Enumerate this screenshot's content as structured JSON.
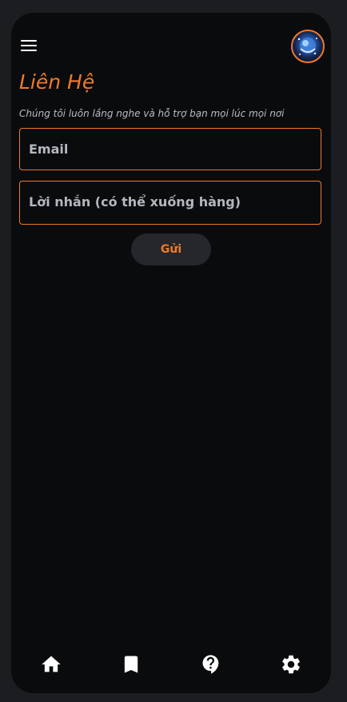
{
  "header": {
    "menu_icon": "hamburger-menu-icon",
    "avatar_icon": "user-avatar-icon"
  },
  "contact": {
    "title": "Liên Hệ",
    "subtitle": "Chúng tôi luôn lắng nghe và hỗ trợ bạn mọi lúc mọi nơi",
    "email_placeholder": "Email",
    "email_value": "",
    "message_placeholder": "Lời nhắn (có thể xuống hàng)",
    "message_value": "",
    "send_label": "Gửi"
  },
  "bottom_nav": {
    "items": [
      {
        "icon": "home-icon"
      },
      {
        "icon": "bookmark-icon"
      },
      {
        "icon": "help-icon"
      },
      {
        "icon": "settings-gear-icon"
      }
    ]
  },
  "colors": {
    "accent": "#f07a2a",
    "background": "#0a0b0d",
    "outer_background": "#1c1d20",
    "button_background": "#25272c"
  }
}
